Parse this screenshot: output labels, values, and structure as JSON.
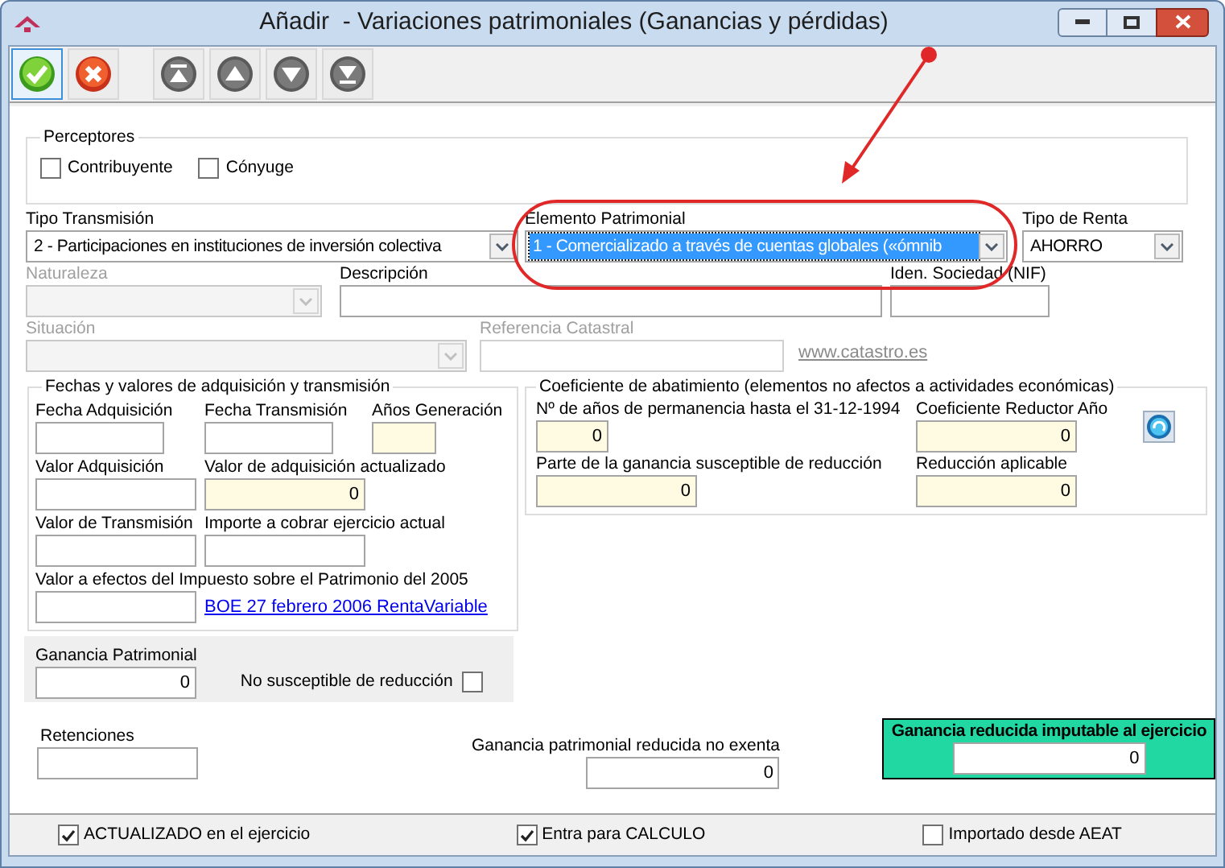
{
  "window": {
    "title": "Añadir  - Variaciones patrimoniales (Ganancias y pérdidas)"
  },
  "toolbar": [
    {
      "kind": "accept",
      "selected": true
    },
    {
      "kind": "cancel",
      "selected": false
    },
    {
      "kind": "first",
      "selected": false
    },
    {
      "kind": "previous",
      "selected": false
    },
    {
      "kind": "next",
      "selected": false
    },
    {
      "kind": "last",
      "selected": false
    }
  ],
  "perceptores": {
    "title": "Perceptores",
    "options": [
      {
        "label": "Contribuyente",
        "checked": false
      },
      {
        "label": "Cónyuge",
        "checked": false
      }
    ]
  },
  "selectors": [
    {
      "label": "Tipo Transmisión",
      "value": "2 - Participaciones en instituciones de inversión colectiva",
      "focused": false
    },
    {
      "label": "Elemento Patrimonial",
      "value": "1 - Comercializado a través de cuentas globales («ómnib",
      "focused": true
    },
    {
      "label": "Tipo de Renta",
      "value": "AHORRO",
      "focused": false
    }
  ],
  "row2": [
    {
      "kind": "dropdown",
      "label": "Naturaleza",
      "disabled": true
    },
    {
      "kind": "text",
      "label": "Descripción",
      "disabled": false
    },
    {
      "kind": "text",
      "label": "Iden. Sociedad (NIF)",
      "disabled": false
    }
  ],
  "row3": [
    {
      "kind": "dropdown",
      "label": "Situación",
      "disabled": true
    },
    {
      "kind": "text",
      "label": "Referencia Catastral",
      "disabled": true
    }
  ],
  "catastro_link": {
    "text": "www.catastro.es",
    "disabled": true
  },
  "fechas": {
    "title": "Fechas y valores de adquisición y transmisión",
    "rows": [
      [
        {
          "label": "Fecha Adquisición",
          "readonly": false
        },
        {
          "label": "Fecha Transmisión",
          "readonly": false
        },
        {
          "label": "Años Generación",
          "readonly": true
        }
      ],
      [
        {
          "label": "Valor Adquisición",
          "readonly": false
        },
        {
          "label": "Valor de adquisición actualizado",
          "value": "0",
          "readonly": true
        }
      ],
      [
        {
          "label": "Valor de Transmisión",
          "readonly": false
        },
        {
          "label": "Importe a cobrar ejercicio actual",
          "readonly": false
        }
      ],
      [
        {
          "label": "Valor a efectos del Impuesto sobre el Patrimonio del 2005",
          "readonly": false
        }
      ]
    ],
    "link": "BOE 27 febrero 2006 RentaVariable"
  },
  "coeficiente": {
    "title": "Coeficiente de abatimiento (elementos no afectos a actividades económicas)",
    "rows": [
      [
        {
          "label": "Nº de años de permanencia hasta el 31-12-1994",
          "value": "0",
          "readonly": true
        },
        {
          "label": "Coeficiente Reductor Año",
          "value": "0",
          "readonly": true
        }
      ],
      [
        {
          "label": "Parte de la ganancia susceptible de reducción",
          "value": "0",
          "readonly": true
        },
        {
          "label": "Reducción aplicable",
          "value": "0",
          "readonly": true
        }
      ]
    ]
  },
  "ganancia_patrimonial": {
    "label": "Ganancia Patrimonial",
    "value": "0"
  },
  "no_susceptible": {
    "label": "No susceptible de reducción",
    "checked": false
  },
  "retenciones": {
    "label": "Retenciones"
  },
  "ganancia_no_exenta": {
    "label": "Ganancia patrimonial reducida no exenta",
    "value": "0"
  },
  "ganancia_imputable": {
    "label": "Ganancia reducida imputable al ejercicio",
    "value": "0"
  },
  "footer": [
    {
      "label": "ACTUALIZADO en el ejercicio",
      "checked": true
    },
    {
      "label": "Entra para CALCULO",
      "checked": true
    },
    {
      "label": "Importado desde AEAT",
      "checked": false
    }
  ]
}
